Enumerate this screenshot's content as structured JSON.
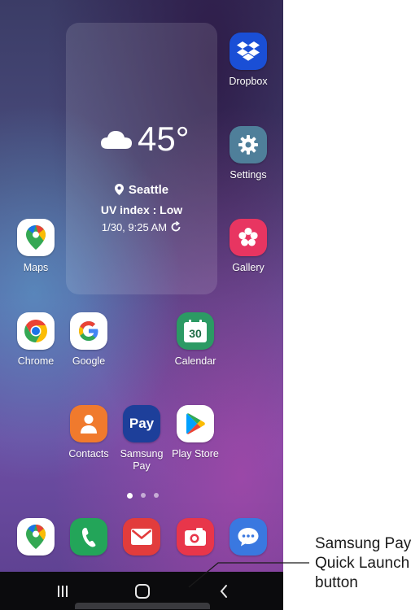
{
  "weather": {
    "temperature": "45°",
    "city": "Seattle",
    "uv": "UV index : Low",
    "updated": "1/30, 9:25 AM"
  },
  "apps": {
    "dropbox": "Dropbox",
    "settings": "Settings",
    "gallery": "Gallery",
    "maps": "Maps",
    "chrome": "Chrome",
    "google": "Google",
    "calendar": "Calendar",
    "calendar_day": "30",
    "contacts": "Contacts",
    "samsung_pay": "Samsung Pay",
    "samsung_pay_icon_text": "Pay",
    "play_store": "Play Store"
  },
  "page_indicator": {
    "count": 3,
    "active": 1
  },
  "dock": {
    "icons": [
      "maps-icon",
      "phone-icon",
      "email-icon",
      "camera-icon",
      "messages-icon"
    ]
  },
  "navigation": {
    "icons": [
      "recents-icon",
      "home-icon",
      "back-icon"
    ]
  },
  "annotation": {
    "line1": "Samsung Pay",
    "line2": "Quick Launch",
    "line3": "button"
  },
  "colors": {
    "dropbox": "#1a4fd6",
    "settings": "#4f7f9a",
    "gallery": "#e83561",
    "contacts": "#f07a2d",
    "samsung_pay": "#1d3f9a",
    "phone": "#23a559",
    "email": "#e23c3c",
    "camera": "#e8364a",
    "messages": "#3a78e0",
    "calendar": "#2c9a64"
  }
}
